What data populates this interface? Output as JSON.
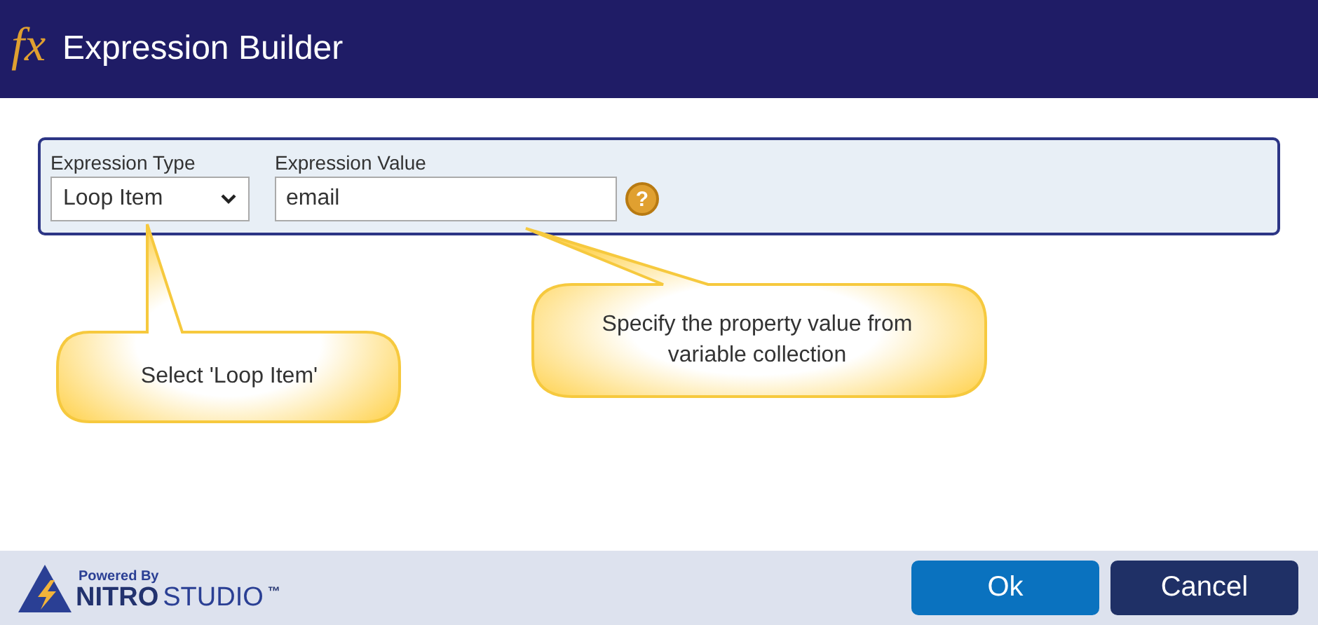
{
  "window": {
    "title": "Expression Builder",
    "icon": "fx"
  },
  "expression_type": {
    "label": "Expression Type",
    "value": "Loop Item"
  },
  "expression_value": {
    "label": "Expression Value",
    "value": "email",
    "help": "?"
  },
  "callouts": [
    {
      "text": "Select 'Loop Item'"
    },
    {
      "text": "Specify the property value from variable collection"
    }
  ],
  "footer": {
    "powered_by": "Powered By",
    "brand_bold": "NITRO",
    "brand_light": "STUDIO",
    "trademark": "™"
  },
  "buttons": [
    {
      "label": "Ok",
      "kind": "primary"
    },
    {
      "label": "Cancel",
      "kind": "secondary"
    }
  ]
}
